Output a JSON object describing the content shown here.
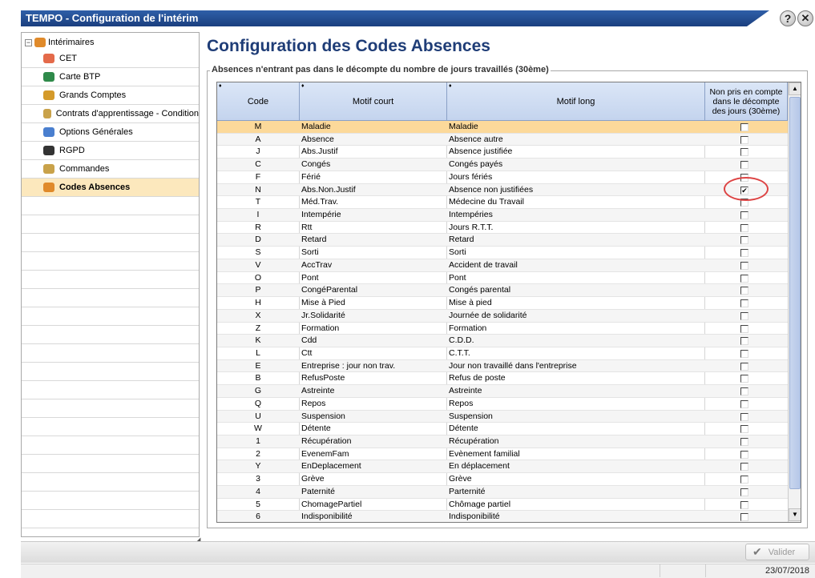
{
  "window": {
    "title": "TEMPO - Configuration de l'intérim",
    "help_glyph": "?",
    "close_glyph": "✕"
  },
  "sidebar": {
    "root": {
      "label": "Intérimaires",
      "expander": "−"
    },
    "items": [
      {
        "label": "CET",
        "icon": "cet-icon",
        "color": "#e46a4a"
      },
      {
        "label": "Carte BTP",
        "icon": "btp-card-icon",
        "color": "#2f8a4a"
      },
      {
        "label": "Grands Comptes",
        "icon": "major-accounts-icon",
        "color": "#d49a2a"
      },
      {
        "label": "Contrats d'apprentissage - Condition",
        "icon": "contracts-icon",
        "color": "#c9a24a"
      },
      {
        "label": "Options Générales",
        "icon": "general-options-icon",
        "color": "#4a7fcf"
      },
      {
        "label": "RGPD",
        "icon": "rgpd-icon",
        "color": "#333333"
      },
      {
        "label": "Commandes",
        "icon": "orders-icon",
        "color": "#c9a24a"
      },
      {
        "label": "Codes Absences",
        "icon": "absence-codes-icon",
        "color": "#e08a2a",
        "selected": true
      }
    ]
  },
  "main": {
    "title": "Configuration des Codes Absences",
    "group_label": "Absences n'entrant pas dans le décompte du nombre de jours travaillés (30ème)",
    "columns": {
      "code": "Code",
      "court": "Motif court",
      "long": "Motif long",
      "excluded": "Non pris en compte dans le décompte des jours (30ème)"
    },
    "rows": [
      {
        "code": "M",
        "court": "Maladie",
        "long": "Maladie",
        "checked": false
      },
      {
        "code": "A",
        "court": "Absence",
        "long": "Absence autre",
        "checked": false
      },
      {
        "code": "J",
        "court": "Abs.Justif",
        "long": "Absence justifiée",
        "checked": false
      },
      {
        "code": "C",
        "court": "Congés",
        "long": "Congés payés",
        "checked": false
      },
      {
        "code": "F",
        "court": "Férié",
        "long": "Jours fériés",
        "checked": false
      },
      {
        "code": "N",
        "court": "Abs.Non.Justif",
        "long": "Absence non justifiées",
        "checked": true
      },
      {
        "code": "T",
        "court": "Méd.Trav.",
        "long": "Médecine du Travail",
        "checked": false
      },
      {
        "code": "I",
        "court": "Intempérie",
        "long": "Intempéries",
        "checked": false
      },
      {
        "code": "R",
        "court": "Rtt",
        "long": "Jours R.T.T.",
        "checked": false
      },
      {
        "code": "D",
        "court": "Retard",
        "long": "Retard",
        "checked": false
      },
      {
        "code": "S",
        "court": "Sorti",
        "long": "Sorti",
        "checked": false
      },
      {
        "code": "V",
        "court": "AccTrav",
        "long": "Accident de travail",
        "checked": false
      },
      {
        "code": "O",
        "court": "Pont",
        "long": "Pont",
        "checked": false
      },
      {
        "code": "P",
        "court": "CongéParental",
        "long": "Congés parental",
        "checked": false
      },
      {
        "code": "H",
        "court": "Mise à Pied",
        "long": "Mise à pied",
        "checked": false
      },
      {
        "code": "X",
        "court": "Jr.Solidarité",
        "long": "Journée de solidarité",
        "checked": false
      },
      {
        "code": "Z",
        "court": "Formation",
        "long": "Formation",
        "checked": false
      },
      {
        "code": "K",
        "court": "Cdd",
        "long": "C.D.D.",
        "checked": false
      },
      {
        "code": "L",
        "court": "Ctt",
        "long": "C.T.T.",
        "checked": false
      },
      {
        "code": "E",
        "court": "Entreprise : jour non trav.",
        "long": "Jour non travaillé dans l'entreprise",
        "checked": false
      },
      {
        "code": "B",
        "court": "RefusPoste",
        "long": "Refus de poste",
        "checked": false
      },
      {
        "code": "G",
        "court": "Astreinte",
        "long": "Astreinte",
        "checked": false
      },
      {
        "code": "Q",
        "court": "Repos",
        "long": "Repos",
        "checked": false
      },
      {
        "code": "U",
        "court": "Suspension",
        "long": "Suspension",
        "checked": false
      },
      {
        "code": "W",
        "court": "Détente",
        "long": "Détente",
        "checked": false
      },
      {
        "code": "1",
        "court": "Récupération",
        "long": "Récupération",
        "checked": false
      },
      {
        "code": "2",
        "court": "EvenemFam",
        "long": "Evènement familial",
        "checked": false
      },
      {
        "code": "Y",
        "court": "EnDeplacement",
        "long": "En déplacement",
        "checked": false
      },
      {
        "code": "3",
        "court": "Grève",
        "long": "Grève",
        "checked": false
      },
      {
        "code": "4",
        "court": "Paternité",
        "long": "Parternité",
        "checked": false
      },
      {
        "code": "5",
        "court": "ChomagePartiel",
        "long": "Chômage partiel",
        "checked": false
      },
      {
        "code": "6",
        "court": "Indisponibilité",
        "long": "Indisponibilité",
        "checked": false
      }
    ]
  },
  "footer": {
    "validate_label": "Valider",
    "validate_icon": "checkmark-icon"
  },
  "status": {
    "date": "23/07/2018"
  }
}
